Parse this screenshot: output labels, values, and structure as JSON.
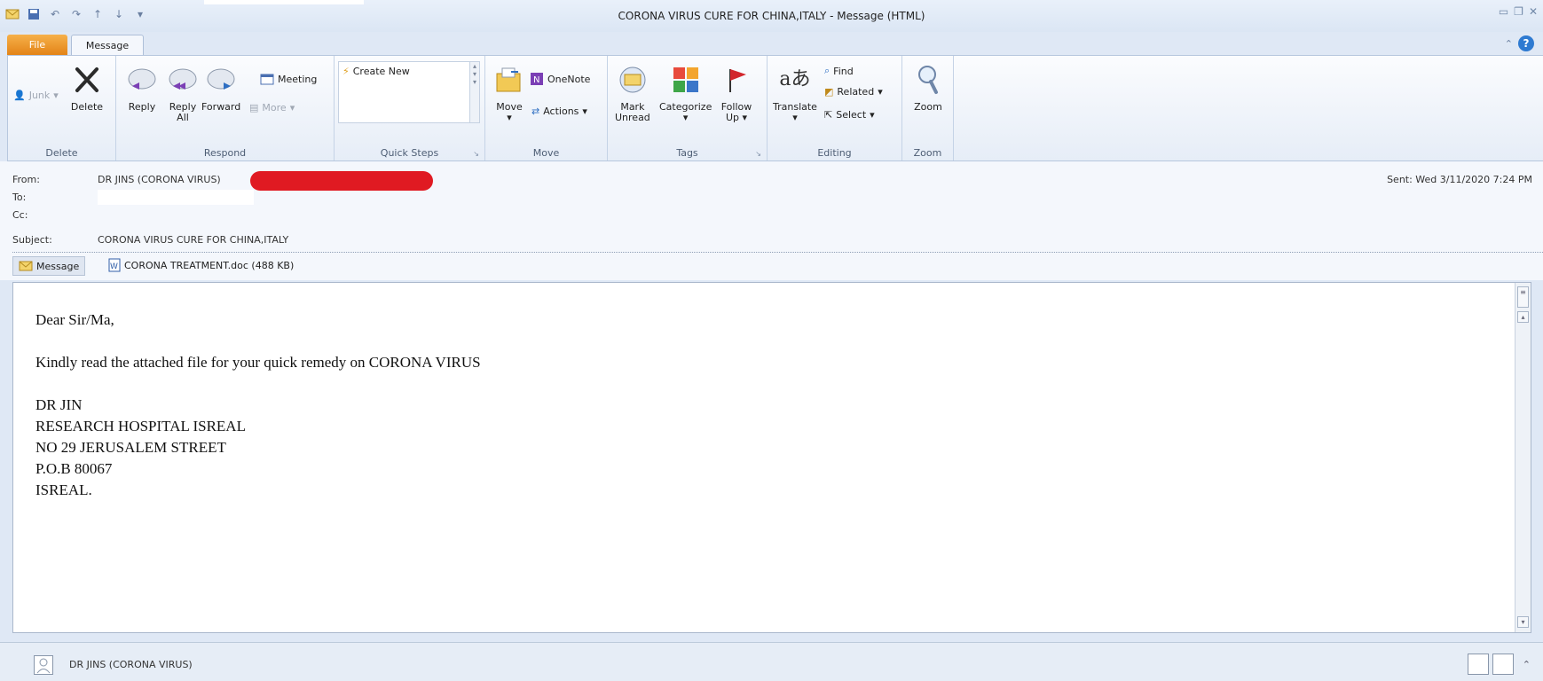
{
  "window": {
    "title": "CORONA VIRUS CURE FOR CHINA,ITALY - Message (HTML)"
  },
  "tabs": {
    "file": "File",
    "message": "Message"
  },
  "ribbon": {
    "delete_group": {
      "junk": "Junk",
      "delete": "Delete",
      "label": "Delete"
    },
    "respond_group": {
      "reply": "Reply",
      "reply_all_1": "Reply",
      "reply_all_2": "All",
      "forward": "Forward",
      "meeting": "Meeting",
      "more": "More",
      "label": "Respond"
    },
    "quicksteps_group": {
      "create_new": "Create New",
      "label": "Quick Steps"
    },
    "move_group": {
      "move": "Move",
      "onenote": "OneNote",
      "actions": "Actions",
      "label": "Move"
    },
    "tags_group": {
      "mark_1": "Mark",
      "mark_2": "Unread",
      "categorize": "Categorize",
      "follow_1": "Follow",
      "follow_2": "Up",
      "label": "Tags"
    },
    "editing_group": {
      "translate": "Translate",
      "find": "Find",
      "related": "Related",
      "select": "Select",
      "label": "Editing"
    },
    "zoom_group": {
      "zoom": "Zoom",
      "label": "Zoom"
    }
  },
  "header": {
    "from_label": "From:",
    "from_value": "DR JINS (CORONA VIRUS)",
    "to_label": "To:",
    "cc_label": "Cc:",
    "subject_label": "Subject:",
    "subject_value": "CORONA VIRUS CURE FOR CHINA,ITALY",
    "sent": "Sent:  Wed 3/11/2020 7:24 PM"
  },
  "attachments": {
    "message_tab": "Message",
    "file": "CORONA TREATMENT.doc (488 KB)"
  },
  "body": {
    "greeting": "Dear Sir/Ma,",
    "line1": "Kindly read the attached file for your quick remedy on CORONA VIRUS",
    "sig1": "DR JIN",
    "sig2": "RESEARCH HOSPITAL ISREAL",
    "sig3": "NO 29 JERUSALEM STREET",
    "sig4": "P.O.B 80067",
    "sig5": "ISREAL."
  },
  "people_pane": {
    "name": "DR JINS (CORONA VIRUS)"
  },
  "colors": {
    "accent": "#e38417",
    "redaction": "#e01a22",
    "ribbon_bg": "#e6edf7"
  }
}
